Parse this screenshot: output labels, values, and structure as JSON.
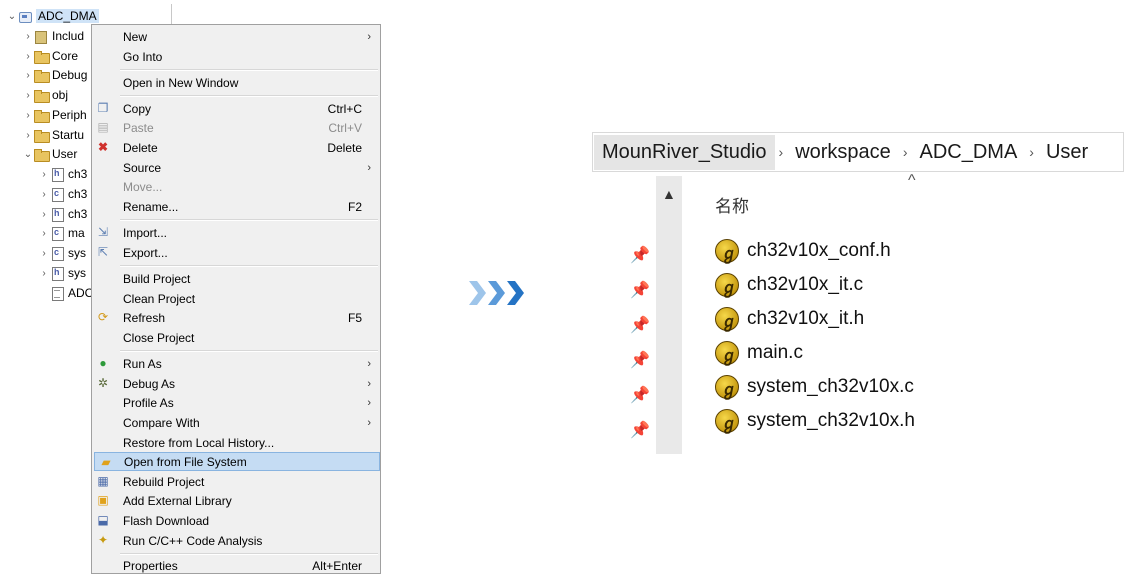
{
  "tree": {
    "root": "ADC_DMA",
    "items": [
      {
        "label": "Includ",
        "icon": "includes-icon"
      },
      {
        "label": "Core",
        "icon": "folder-icon"
      },
      {
        "label": "Debug",
        "icon": "folder-icon"
      },
      {
        "label": "obj",
        "icon": "folder-icon"
      },
      {
        "label": "Periph",
        "icon": "folder-icon"
      },
      {
        "label": "Startu",
        "icon": "folder-icon"
      },
      {
        "label": "User",
        "icon": "folder-icon"
      },
      {
        "label": "ch3",
        "icon": "h-file-icon"
      },
      {
        "label": "ch3",
        "icon": "c-file-icon"
      },
      {
        "label": "ch3",
        "icon": "h-file-icon"
      },
      {
        "label": "ma",
        "icon": "c-file-icon"
      },
      {
        "label": "sys",
        "icon": "c-file-icon"
      },
      {
        "label": "sys",
        "icon": "h-file-icon"
      },
      {
        "label": "ADC_D",
        "icon": "file-icon"
      }
    ]
  },
  "menu": {
    "items": [
      {
        "label": "New",
        "shortcut": ""
      },
      {
        "label": "Go Into",
        "shortcut": ""
      },
      {
        "label": "Open in New Window",
        "shortcut": ""
      },
      {
        "label": "Copy",
        "shortcut": "Ctrl+C"
      },
      {
        "label": "Paste",
        "shortcut": "Ctrl+V"
      },
      {
        "label": "Delete",
        "shortcut": "Delete"
      },
      {
        "label": "Source",
        "shortcut": ""
      },
      {
        "label": "Move...",
        "shortcut": ""
      },
      {
        "label": "Rename...",
        "shortcut": "F2"
      },
      {
        "label": "Import...",
        "shortcut": ""
      },
      {
        "label": "Export...",
        "shortcut": ""
      },
      {
        "label": "Build Project",
        "shortcut": ""
      },
      {
        "label": "Clean Project",
        "shortcut": ""
      },
      {
        "label": "Refresh",
        "shortcut": "F5"
      },
      {
        "label": "Close Project",
        "shortcut": ""
      },
      {
        "label": "Run As",
        "shortcut": ""
      },
      {
        "label": "Debug As",
        "shortcut": ""
      },
      {
        "label": "Profile As",
        "shortcut": ""
      },
      {
        "label": "Compare With",
        "shortcut": ""
      },
      {
        "label": "Restore from Local History...",
        "shortcut": ""
      },
      {
        "label": "Open from File System",
        "shortcut": ""
      },
      {
        "label": "Rebuild Project",
        "shortcut": ""
      },
      {
        "label": "Add External Library",
        "shortcut": ""
      },
      {
        "label": "Flash Download",
        "shortcut": ""
      },
      {
        "label": "Run C/C++ Code Analysis",
        "shortcut": ""
      },
      {
        "label": "Properties",
        "shortcut": "Alt+Enter"
      }
    ],
    "highlight_color": "#c5dcf3"
  },
  "arrows": {
    "colors": [
      "#9ec5ea",
      "#5b9ad9",
      "#2473c4"
    ]
  },
  "explorer": {
    "breadcrumb": [
      "MounRiver_Studio",
      "workspace",
      "ADC_DMA",
      "User"
    ],
    "column_header": "名称",
    "files": [
      "ch32v10x_conf.h",
      "ch32v10x_it.c",
      "ch32v10x_it.h",
      "main.c",
      "system_ch32v10x.c",
      "system_ch32v10x.h"
    ]
  }
}
